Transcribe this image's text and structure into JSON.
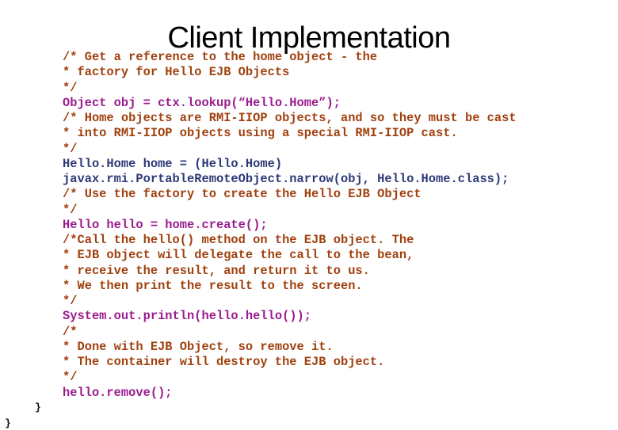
{
  "slide": {
    "title": "Client Implementation"
  },
  "colors": {
    "comment": "#a0400e",
    "statement_magenta": "#9a1c8e",
    "statement_navy": "#2e3a78",
    "brace": "#111111"
  },
  "code": {
    "lines": [
      {
        "text": "/* Get a reference to the home object - the",
        "kind": "comment"
      },
      {
        "text": "* factory for Hello EJB Objects",
        "kind": "comment"
      },
      {
        "text": "*/",
        "kind": "comment"
      },
      {
        "text": "Object obj = ctx.lookup(“Hello.Home”);",
        "kind": "magenta"
      },
      {
        "text": "/* Home objects are RMI-IIOP objects, and so they must be cast",
        "kind": "comment"
      },
      {
        "text": "* into RMI-IIOP objects using a special RMI-IIOP cast.",
        "kind": "comment"
      },
      {
        "text": "*/",
        "kind": "comment"
      },
      {
        "text": "Hello.Home home = (Hello.Home)",
        "kind": "navy"
      },
      {
        "text": "javax.rmi.PortableRemoteObject.narrow(obj, Hello.Home.class);",
        "kind": "navy"
      },
      {
        "text": "/* Use the factory to create the Hello EJB Object",
        "kind": "comment"
      },
      {
        "text": "*/",
        "kind": "comment"
      },
      {
        "text": "Hello hello = home.create();",
        "kind": "magenta"
      },
      {
        "text": "/*Call the hello() method on the EJB object. The",
        "kind": "comment"
      },
      {
        "text": "* EJB object will delegate the call to the bean,",
        "kind": "comment"
      },
      {
        "text": "* receive the result, and return it to us.",
        "kind": "comment"
      },
      {
        "text": "* We then print the result to the screen.",
        "kind": "comment"
      },
      {
        "text": "*/",
        "kind": "comment"
      },
      {
        "text": "System.out.println(hello.hello());",
        "kind": "magenta"
      },
      {
        "text": "/*",
        "kind": "comment"
      },
      {
        "text": "* Done with EJB Object, so remove it.",
        "kind": "comment"
      },
      {
        "text": "* The container will destroy the EJB object.",
        "kind": "comment"
      },
      {
        "text": "*/",
        "kind": "comment"
      },
      {
        "text": "hello.remove();",
        "kind": "magenta"
      }
    ],
    "closing_brace_inner": "}",
    "closing_brace_outer": "}"
  }
}
